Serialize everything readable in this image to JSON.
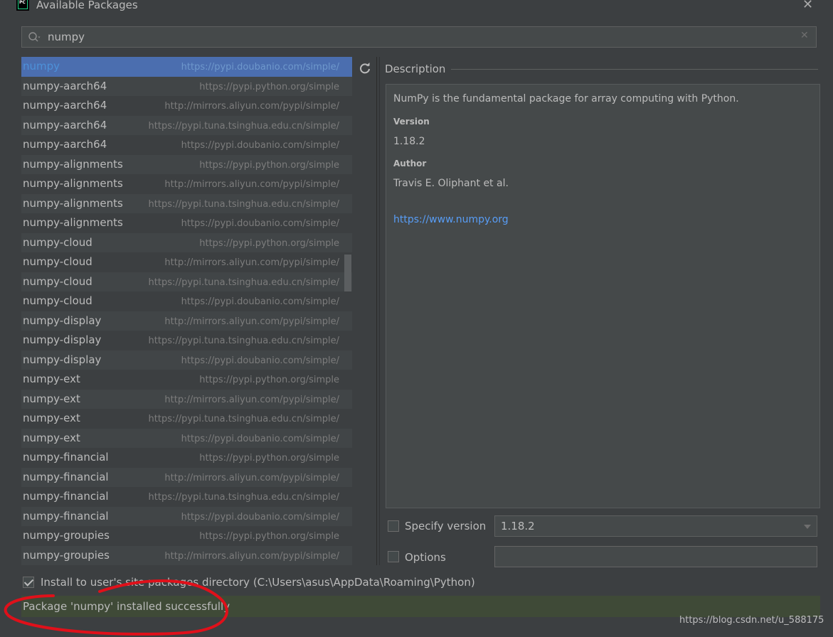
{
  "window": {
    "title": "Available Packages",
    "logo_text": "PC",
    "close_glyph": "✕"
  },
  "search": {
    "value": "numpy",
    "clear_glyph": "✕"
  },
  "packages": [
    {
      "name": "numpy",
      "repo": "https://pypi.doubanio.com/simple/",
      "selected": true
    },
    {
      "name": "numpy-aarch64",
      "repo": "https://pypi.python.org/simple"
    },
    {
      "name": "numpy-aarch64",
      "repo": "http://mirrors.aliyun.com/pypi/simple/"
    },
    {
      "name": "numpy-aarch64",
      "repo": "https://pypi.tuna.tsinghua.edu.cn/simple/"
    },
    {
      "name": "numpy-aarch64",
      "repo": "https://pypi.doubanio.com/simple/"
    },
    {
      "name": "numpy-alignments",
      "repo": "https://pypi.python.org/simple"
    },
    {
      "name": "numpy-alignments",
      "repo": "http://mirrors.aliyun.com/pypi/simple/"
    },
    {
      "name": "numpy-alignments",
      "repo": "https://pypi.tuna.tsinghua.edu.cn/simple/"
    },
    {
      "name": "numpy-alignments",
      "repo": "https://pypi.doubanio.com/simple/"
    },
    {
      "name": "numpy-cloud",
      "repo": "https://pypi.python.org/simple"
    },
    {
      "name": "numpy-cloud",
      "repo": "http://mirrors.aliyun.com/pypi/simple/"
    },
    {
      "name": "numpy-cloud",
      "repo": "https://pypi.tuna.tsinghua.edu.cn/simple/"
    },
    {
      "name": "numpy-cloud",
      "repo": "https://pypi.doubanio.com/simple/"
    },
    {
      "name": "numpy-display",
      "repo": "http://mirrors.aliyun.com/pypi/simple/"
    },
    {
      "name": "numpy-display",
      "repo": "https://pypi.tuna.tsinghua.edu.cn/simple/"
    },
    {
      "name": "numpy-display",
      "repo": "https://pypi.doubanio.com/simple/"
    },
    {
      "name": "numpy-ext",
      "repo": "https://pypi.python.org/simple"
    },
    {
      "name": "numpy-ext",
      "repo": "http://mirrors.aliyun.com/pypi/simple/"
    },
    {
      "name": "numpy-ext",
      "repo": "https://pypi.tuna.tsinghua.edu.cn/simple/"
    },
    {
      "name": "numpy-ext",
      "repo": "https://pypi.doubanio.com/simple/"
    },
    {
      "name": "numpy-financial",
      "repo": "https://pypi.python.org/simple"
    },
    {
      "name": "numpy-financial",
      "repo": "http://mirrors.aliyun.com/pypi/simple/"
    },
    {
      "name": "numpy-financial",
      "repo": "https://pypi.tuna.tsinghua.edu.cn/simple/"
    },
    {
      "name": "numpy-financial",
      "repo": "https://pypi.doubanio.com/simple/"
    },
    {
      "name": "numpy-groupies",
      "repo": "https://pypi.python.org/simple"
    },
    {
      "name": "numpy-groupies",
      "repo": "http://mirrors.aliyun.com/pypi/simple/"
    }
  ],
  "description": {
    "header": "Description",
    "summary": "NumPy is the fundamental package for array computing with Python.",
    "version_label": "Version",
    "version_value": "1.18.2",
    "author_label": "Author",
    "author_value": "Travis E. Oliphant et al.",
    "homepage": "https://www.numpy.org"
  },
  "specify_version": {
    "label": "Specify version",
    "checked": false,
    "value": "1.18.2"
  },
  "options": {
    "label": "Options",
    "checked": false,
    "value": ""
  },
  "install_user": {
    "label": "Install to user's site packages directory (C:\\Users\\asus\\AppData\\Roaming\\Python)",
    "checked": true
  },
  "status": {
    "message": "Package 'numpy' installed successfully"
  },
  "watermark": "https://blog.csdn.net/u_588175",
  "colors": {
    "background": "#3c3f41",
    "selection": "#4b6eaf",
    "link": "#589df6",
    "status_bg": "#3f4a37",
    "annotation": "#e0101a"
  }
}
